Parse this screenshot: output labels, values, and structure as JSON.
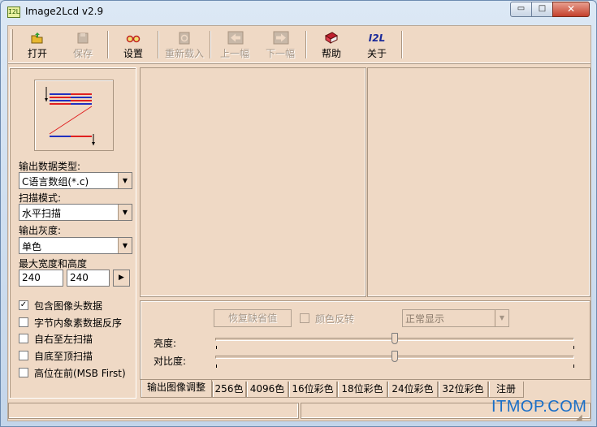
{
  "window": {
    "title": "Image2Lcd v2.9",
    "icon_text": "I2L",
    "minimize_glyph": "▭",
    "maximize_glyph": "□",
    "close_glyph": "✕"
  },
  "toolbar": {
    "items": [
      {
        "label": "打开",
        "icon": "open-folder-icon",
        "enabled": true
      },
      {
        "label": "保存",
        "icon": "save-disk-icon",
        "enabled": false
      },
      {
        "label": "设置",
        "icon": "glasses-icon",
        "enabled": true
      },
      {
        "label": "重新载入",
        "icon": "reload-icon",
        "enabled": false
      },
      {
        "label": "上一幅",
        "icon": "previous-arrow-icon",
        "enabled": false
      },
      {
        "label": "下一幅",
        "icon": "next-arrow-icon",
        "enabled": false
      },
      {
        "label": "帮助",
        "icon": "help-book-icon",
        "enabled": true
      },
      {
        "label": "关于",
        "icon": "about-logo-icon",
        "enabled": true
      }
    ],
    "about_icon_text": "I2L"
  },
  "left_panel": {
    "output_type_label": "输出数据类型:",
    "output_type_value": "C语言数组(*.c)",
    "scan_mode_label": "扫描模式:",
    "scan_mode_value": "水平扫描",
    "gray_label": "输出灰度:",
    "gray_value": "单色",
    "max_size_label": "最大宽度和高度",
    "max_width": "240",
    "max_height": "240",
    "apply_glyph": "▶",
    "checkboxes": [
      {
        "label": "包含图像头数据",
        "checked": true
      },
      {
        "label": "字节内象素数据反序",
        "checked": false
      },
      {
        "label": "自右至左扫描",
        "checked": false
      },
      {
        "label": "自底至顶扫描",
        "checked": false
      },
      {
        "label": "高位在前(MSB First)",
        "checked": false
      }
    ]
  },
  "adjust_panel": {
    "restore_defaults": "恢复缺省值",
    "invert_color": "颜色反转",
    "display_mode": "正常显示",
    "brightness_label": "亮度:",
    "brightness_level": 0.5,
    "contrast_label": "对比度:",
    "contrast_level": 0.5
  },
  "tabs": [
    {
      "label": "输出图像调整",
      "active": true
    },
    {
      "label": "256色",
      "active": false
    },
    {
      "label": "4096色",
      "active": false
    },
    {
      "label": "16位彩色",
      "active": false
    },
    {
      "label": "18位彩色",
      "active": false
    },
    {
      "label": "24位彩色",
      "active": false
    },
    {
      "label": "32位彩色",
      "active": false
    },
    {
      "label": "注册",
      "active": false
    }
  ],
  "watermark": "ITMOP.COM",
  "colors": {
    "face": "#efd9c5",
    "shadow": "#a89480",
    "disabled_text": "#a59585",
    "watermark": "#1a6fc8"
  }
}
